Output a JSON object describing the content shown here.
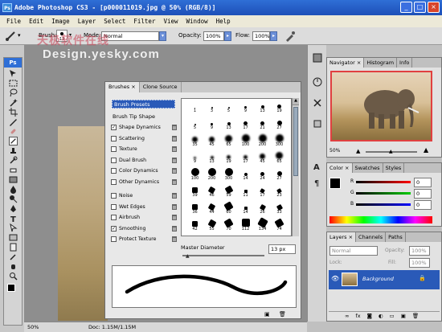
{
  "app": {
    "logo_text": "Ps",
    "title": "Adobe Photoshop CS3 - [p000011019.jpg @ 50% (RGB/8)]",
    "window_buttons": [
      "_",
      "□",
      "×"
    ]
  },
  "menu": [
    "File",
    "Edit",
    "Image",
    "Layer",
    "Select",
    "Filter",
    "View",
    "Window",
    "Help"
  ],
  "options_bar": {
    "brush_label": "Brush:",
    "brush_size": "13",
    "mode_label": "Mode:",
    "mode_value": "Normal",
    "opacity_label": "Opacity:",
    "opacity_value": "100%",
    "flow_label": "Flow:",
    "flow_value": "100%"
  },
  "watermark": {
    "line1": "天极软件在线",
    "line2": "Design.yesky.com"
  },
  "status": {
    "zoom": "50%",
    "doc": "Doc: 1.15M/1.15M"
  },
  "brushes_panel": {
    "tabs": [
      "Brushes",
      "Clone Source"
    ],
    "presets_label": "Brush Presets",
    "tip_label": "Brush Tip Shape",
    "options": [
      {
        "label": "Shape Dynamics",
        "checked": true
      },
      {
        "label": "Scattering",
        "checked": false
      },
      {
        "label": "Texture",
        "checked": false
      },
      {
        "label": "Dual Brush",
        "checked": false
      },
      {
        "label": "Color Dynamics",
        "checked": false
      },
      {
        "label": "Other Dynamics",
        "checked": false
      },
      {
        "label": "Noise",
        "checked": false
      },
      {
        "label": "Wet Edges",
        "checked": false
      },
      {
        "label": "Airbrush",
        "checked": false
      },
      {
        "label": "Smoothing",
        "checked": true
      },
      {
        "label": "Protect Texture",
        "checked": false
      }
    ],
    "brush_grid_labels": [
      [
        "1",
        "3",
        "5",
        "9",
        "13",
        "19"
      ],
      [
        "5",
        "9",
        "13",
        "17",
        "21",
        "27"
      ],
      [
        "35",
        "45",
        "65",
        "100",
        "200",
        "300"
      ],
      [
        "9",
        "13",
        "19",
        "17",
        "45",
        "65"
      ],
      [
        "100",
        "200",
        "300",
        "14",
        "24",
        "27"
      ],
      [
        "39",
        "46",
        "59",
        "11",
        "17",
        "23"
      ],
      [
        "36",
        "44",
        "60",
        "14",
        "26",
        "33"
      ],
      [
        "42",
        "55",
        "70",
        "112",
        "134",
        "74"
      ]
    ],
    "master_diameter_label": "Master Diameter",
    "master_diameter_value": "13 px"
  },
  "navigator": {
    "tabs": [
      "Navigator",
      "Histogram",
      "Info"
    ],
    "zoom": "50%"
  },
  "color_panel": {
    "tabs": [
      "Color",
      "Swatches",
      "Styles"
    ],
    "channels": [
      {
        "label": "R",
        "value": "0"
      },
      {
        "label": "G",
        "value": "0"
      },
      {
        "label": "B",
        "value": "0"
      }
    ]
  },
  "layers_panel": {
    "tabs": [
      "Layers",
      "Channels",
      "Paths"
    ],
    "blend_mode": "Normal",
    "opacity_label": "Opacity:",
    "opacity_value": "100%",
    "lock_label": "Lock:",
    "fill_label": "Fill:",
    "fill_value": "100%",
    "layer_name": "Background"
  },
  "colors": {
    "title_bar": "#1d4fb8",
    "selection": "#2a5ab8",
    "highlight": "#e04040"
  }
}
